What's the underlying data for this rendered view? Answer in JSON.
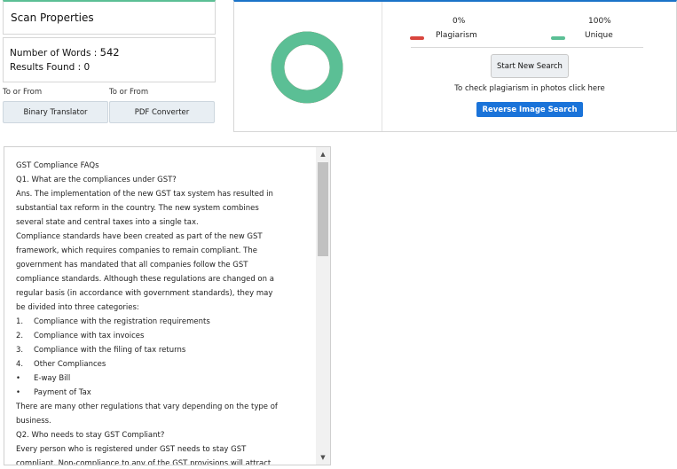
{
  "scan_properties": {
    "title": "Scan Properties",
    "words_label": "Number of Words : ",
    "words_value": "542",
    "results_label": "Results Found : ",
    "results_value": "0"
  },
  "tools": {
    "left_caption": "To or From",
    "left_button": "Binary Translator",
    "right_caption": "To or From",
    "right_button": "PDF Converter"
  },
  "results": {
    "plagiarism_percent": "0%",
    "unique_percent": "100%",
    "plagiarism_label": "Plagiarism",
    "unique_label": "Unique",
    "plagiarism_color": "#d9453d",
    "unique_color": "#5bbf95",
    "plagiarism_fraction": 0,
    "unique_fraction": 1,
    "start_button": "Start New Search",
    "photo_text": "To check plagiarism in photos click here",
    "reverse_button": "Reverse Image Search",
    "reverse_color": "#1a73d9"
  },
  "document": {
    "lines": [
      {
        "text": "GST Compliance FAQs"
      },
      {
        "text": "Q1. What are the compliances under GST?"
      },
      {
        "text": "Ans. The implementation of the new GST tax system has resulted in"
      },
      {
        "text": "substantial tax reform in the country. The new system combines"
      },
      {
        "text": "several state and central taxes into a single tax."
      },
      {
        "text": "Compliance standards have been created as part of the new GST"
      },
      {
        "text": "framework, which requires companies to remain compliant. The"
      },
      {
        "text": "government has mandated that all companies follow the GST"
      },
      {
        "text": "compliance standards. Although these regulations are changed on a"
      },
      {
        "text": "regular basis (in accordance with government standards), they may"
      },
      {
        "text": "be divided into three categories:"
      },
      {
        "marker": "1.",
        "text": "Compliance with the registration requirements"
      },
      {
        "marker": "2.",
        "text": "Compliance with tax invoices"
      },
      {
        "marker": "3.",
        "text": "Compliance with the filing of tax returns"
      },
      {
        "marker": "4.",
        "text": "Other Compliances"
      },
      {
        "marker": "•",
        "text": "E-way Bill"
      },
      {
        "marker": "•",
        "text": "Payment of Tax"
      },
      {
        "text": "There are many other regulations that vary depending on the type of"
      },
      {
        "text": "business."
      },
      {
        "text": "Q2. Who needs to stay GST Compliant?"
      },
      {
        "text": "Every person who is registered under GST needs to stay GST"
      },
      {
        "text": "compliant. Non-compliance to any of the GST provisions will attract"
      }
    ]
  }
}
